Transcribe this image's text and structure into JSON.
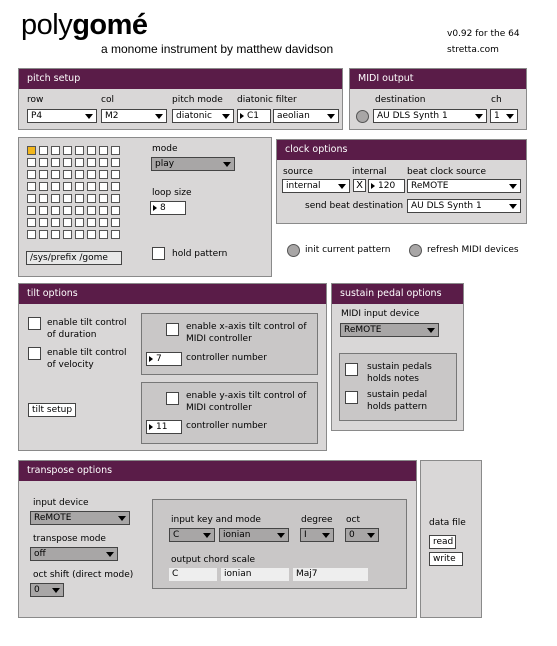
{
  "header": {
    "title_light": "poly",
    "title_bold": "gomé",
    "subtitle": "a monome instrument by matthew davidson",
    "version": "v0.92 for the 64",
    "site": "stretta.com"
  },
  "pitch_setup": {
    "title": "pitch setup",
    "row_label": "row",
    "row_value": "P4",
    "col_label": "col",
    "col_value": "M2",
    "pitch_mode_label": "pitch mode",
    "pitch_mode_value": "diatonic",
    "diatonic_filter_label": "diatonic filter",
    "diatonic_root_value": "C1",
    "diatonic_scale_value": "aeolian"
  },
  "midi_output": {
    "title": "MIDI output",
    "destination_label": "destination",
    "destination_value": "AU DLS Synth 1",
    "ch_label": "ch",
    "ch_value": "1"
  },
  "grid": {
    "lit_cells": [
      [
        0,
        0
      ]
    ],
    "mode_label": "mode",
    "mode_value": "play",
    "loop_size_label": "loop size",
    "loop_size_value": "8",
    "hold_pattern_label": "hold pattern",
    "prefix_value": "/sys/prefix /gome"
  },
  "clock_options": {
    "title": "clock options",
    "source_label": "source",
    "source_value": "internal",
    "internal_label": "internal",
    "internal_toggle": "X",
    "internal_value": "120",
    "beat_clock_source_label": "beat clock source",
    "beat_clock_source_value": "ReMOTE",
    "send_beat_label": "send beat destination :",
    "send_beat_value": "AU DLS Synth 1"
  },
  "actions": {
    "init_pattern_label": "init current pattern",
    "refresh_midi_label": "refresh MIDI devices"
  },
  "tilt_options": {
    "title": "tilt options",
    "duration_label": "enable tilt control of duration",
    "velocity_label": "enable tilt control of velocity",
    "setup_button": "tilt setup",
    "x_axis_label": "enable x-axis tilt control of MIDI controller",
    "x_controller_value": "7",
    "x_controller_label": "controller number",
    "y_axis_label": "enable y-axis tilt control of MIDI controller",
    "y_controller_value": "11",
    "y_controller_label": "controller number"
  },
  "sustain_pedal": {
    "title": "sustain pedal options",
    "input_label": "MIDI input device",
    "input_value": "ReMOTE",
    "holds_notes_label": "sustain pedals holds notes",
    "holds_pattern_label": "sustain pedal holds pattern"
  },
  "transpose_options": {
    "title": "transpose options",
    "input_device_label": "input device",
    "input_device_value": "ReMOTE",
    "mode_label": "transpose mode",
    "mode_value": "off",
    "oct_shift_label": "oct shift (direct mode)",
    "oct_shift_value": "0",
    "key_mode_label": "input key and mode",
    "key_value": "C",
    "key_mode_value": "ionian",
    "degree_label": "degree",
    "degree_value": "I",
    "oct_label": "oct",
    "oct_value": "0",
    "output_label": "output chord scale",
    "out_key": "C",
    "out_mode": "ionian",
    "out_chord": "Maj7"
  },
  "data_file": {
    "label": "data file",
    "read_button": "read",
    "write_button": "write"
  },
  "colors": {
    "header_bar": "#5a1c48",
    "panel": "#d9d7d7",
    "lit_cell": "#f2b61c"
  }
}
